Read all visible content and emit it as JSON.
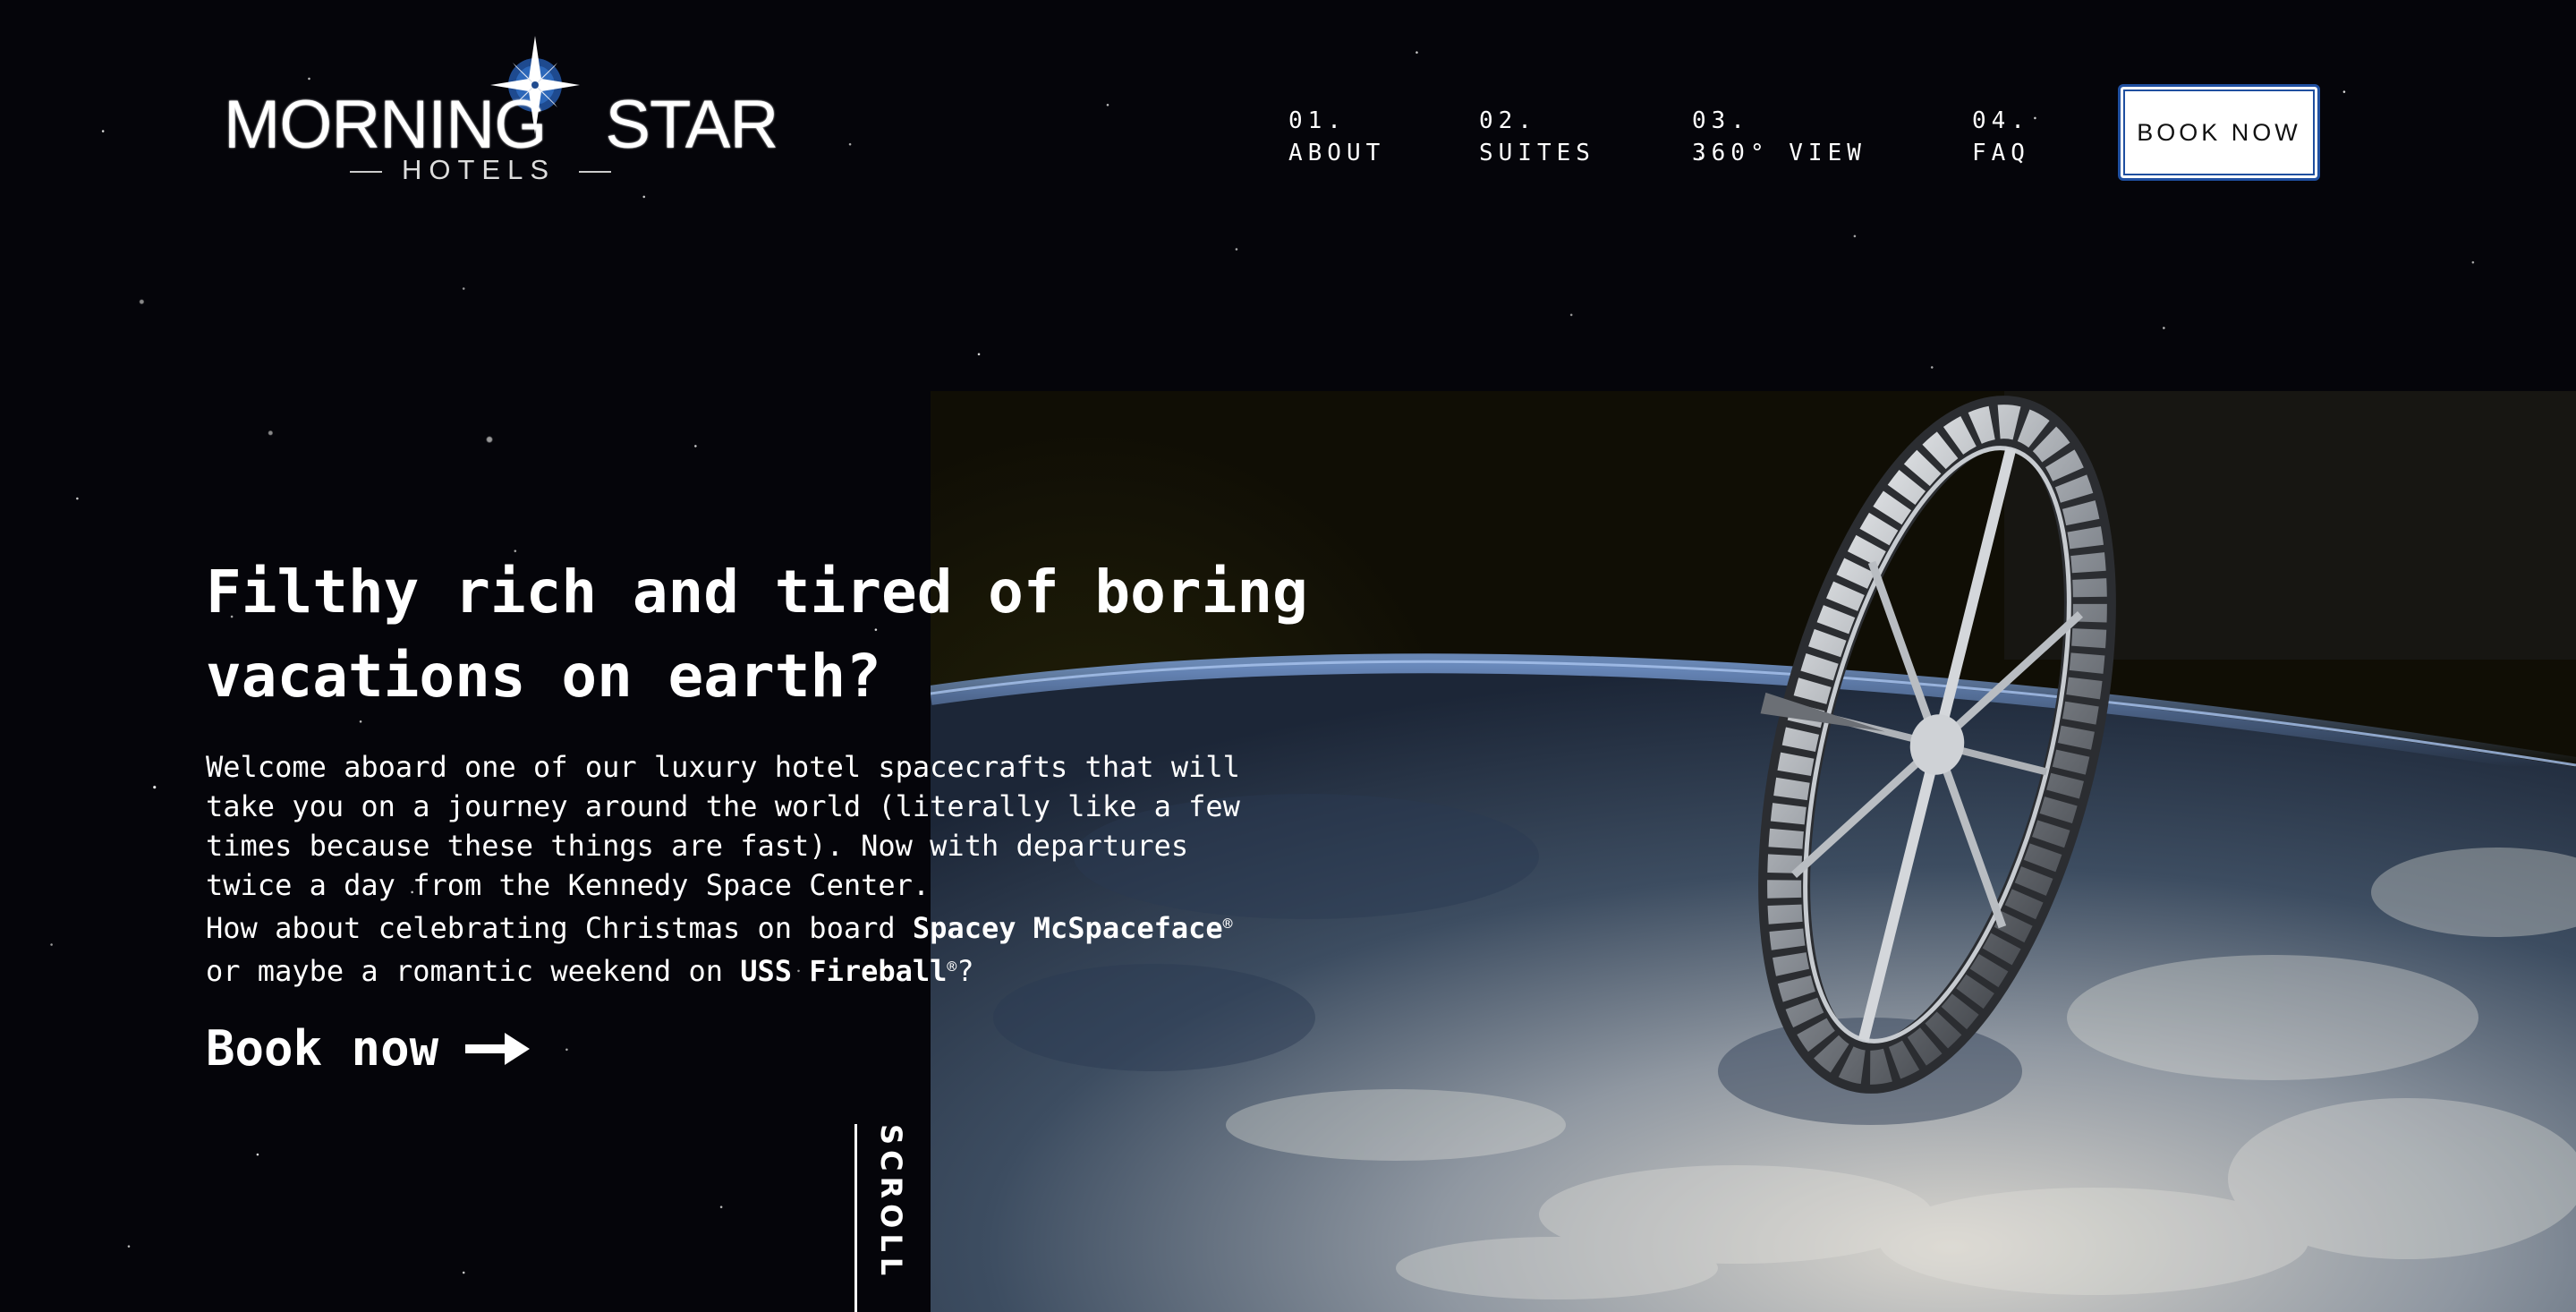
{
  "brand": {
    "name_left": "MORNING",
    "name_right": "STAR",
    "subtitle": "HOTELS"
  },
  "nav": {
    "items": [
      {
        "number": "01.",
        "label": "ABOUT"
      },
      {
        "number": "02.",
        "label": "SUITES"
      },
      {
        "number": "03.",
        "label": "360° VIEW"
      },
      {
        "number": "04.",
        "label": "FAQ"
      }
    ],
    "cta_label": "BOOK NOW"
  },
  "hero": {
    "headline_line1": "Filthy rich and tired of boring",
    "headline_line2": "vacations on earth?",
    "body_line1": "Welcome aboard one of our luxury hotel spacecrafts that will",
    "body_line2": "take you on a journey around the world (literally like a few",
    "body_line3": "times because these things are fast). Now with departures",
    "body_line4": "twice a day from the Kennedy Space Center.",
    "body_line5_prefix": "How about celebrating Christmas on board ",
    "ship_1": "Spacey McSpaceface",
    "body_line6_prefix": "or maybe a romantic weekend on ",
    "ship_2": "USS Fireball",
    "trademark": "®",
    "question_mark": "?",
    "cta_label": "Book now",
    "scroll_label": "SCROLL"
  },
  "colors": {
    "background": "#05050a",
    "button_border": "#1f4fa0",
    "text": "#ffffff"
  },
  "icons": {
    "logo": "compass-star-icon",
    "cta": "arrow-right-icon"
  }
}
